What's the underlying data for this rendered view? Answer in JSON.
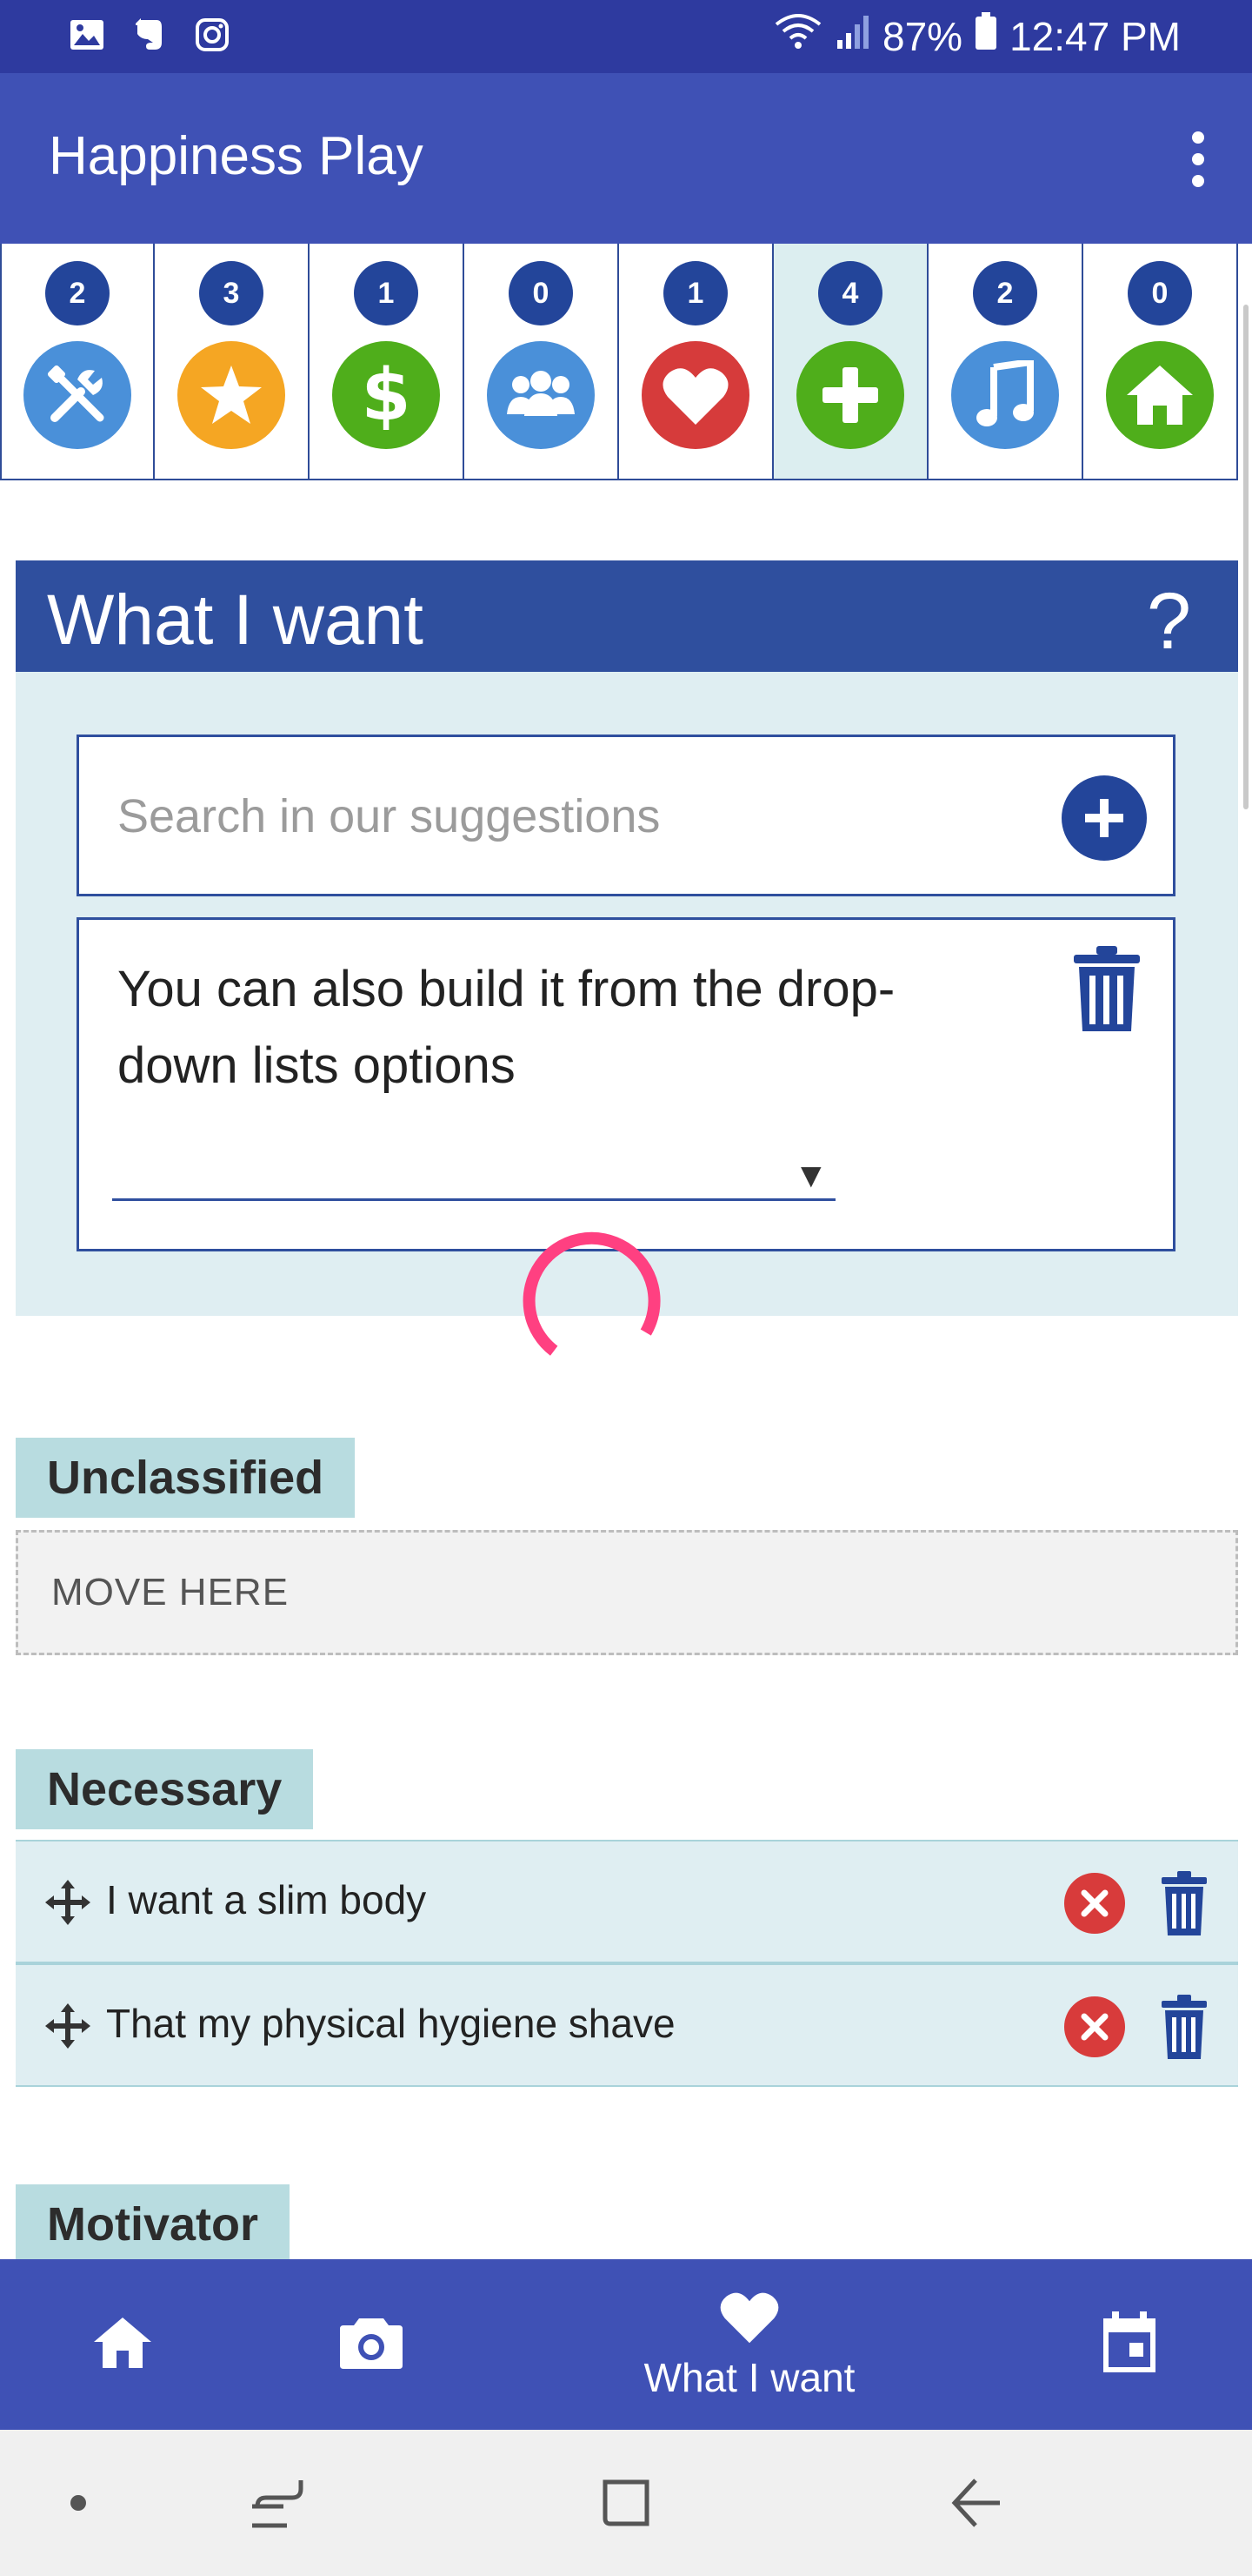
{
  "status_bar": {
    "battery": "87%",
    "time": "12:47 PM",
    "left_icons": [
      "gallery-icon",
      "evernote-icon",
      "instagram-icon"
    ],
    "right_icons": [
      "wifi-icon",
      "signal-icon",
      "battery-icon"
    ]
  },
  "app_bar": {
    "title": "Happiness Play",
    "menu_icon": "more-vert-icon"
  },
  "categories": [
    {
      "count": "2",
      "icon": "tools-icon",
      "color": "#4a90d9"
    },
    {
      "count": "3",
      "icon": "star-icon",
      "color": "#f5a623"
    },
    {
      "count": "1",
      "icon": "dollar-icon",
      "color": "#4fae1b"
    },
    {
      "count": "0",
      "icon": "people-icon",
      "color": "#4a90d9"
    },
    {
      "count": "1",
      "icon": "heart-icon",
      "color": "#d63b3b"
    },
    {
      "count": "4",
      "icon": "plus-icon",
      "color": "#4fae1b",
      "active": true
    },
    {
      "count": "2",
      "icon": "music-icon",
      "color": "#4a90d9"
    },
    {
      "count": "0",
      "icon": "home-icon",
      "color": "#4fae1b"
    }
  ],
  "section": {
    "title": "What I want",
    "help": "?",
    "search_placeholder": "Search in our suggestions",
    "builder_text": "You can also build it from the drop-down lists options"
  },
  "groups": {
    "unclassified": {
      "label": "Unclassified",
      "dropzone": "MOVE HERE"
    },
    "necessary": {
      "label": "Necessary",
      "items": [
        "I want a slim body",
        "That my physical hygiene shave"
      ]
    },
    "motivator": {
      "label": "Motivator"
    }
  },
  "bottom_nav": {
    "active_label": "What I want",
    "items": [
      "home-icon",
      "camera-icon",
      "heart-icon",
      "calendar-icon"
    ]
  },
  "colors": {
    "primary": "#3f51b5",
    "dark_blue": "#2f4f9e",
    "light_bg": "#dfeef2",
    "label_bg": "#b8dce0",
    "spinner": "#ff4081"
  }
}
